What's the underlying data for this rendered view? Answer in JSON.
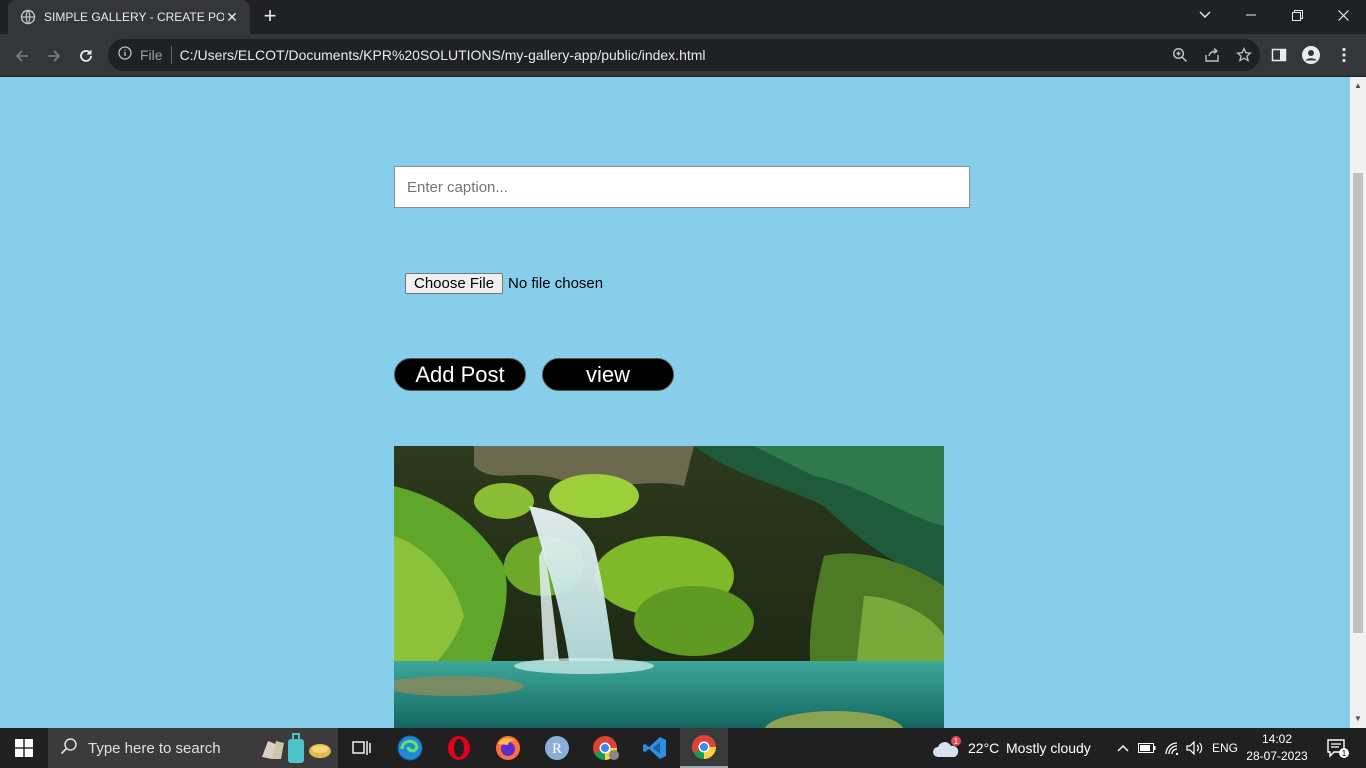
{
  "browser": {
    "tab_title": "SIMPLE GALLERY - CREATE POST",
    "file_label": "File",
    "url": "C:/Users/ELCOT/Documents/KPR%20SOLUTIONS/my-gallery-app/public/index.html"
  },
  "form": {
    "caption_placeholder": "Enter caption...",
    "choose_file_label": "Choose File",
    "no_file_text": "No file chosen",
    "add_post_label": "Add Post",
    "view_label": "view"
  },
  "taskbar": {
    "search_placeholder": "Type here to search",
    "weather_badge": "1",
    "temperature": "22°C",
    "weather": "Mostly cloudy",
    "language": "ENG",
    "time": "14:02",
    "date": "28-07-2023",
    "notification_count": "1"
  },
  "colors": {
    "page_background": "#87ceeb",
    "button_background": "#000000"
  }
}
